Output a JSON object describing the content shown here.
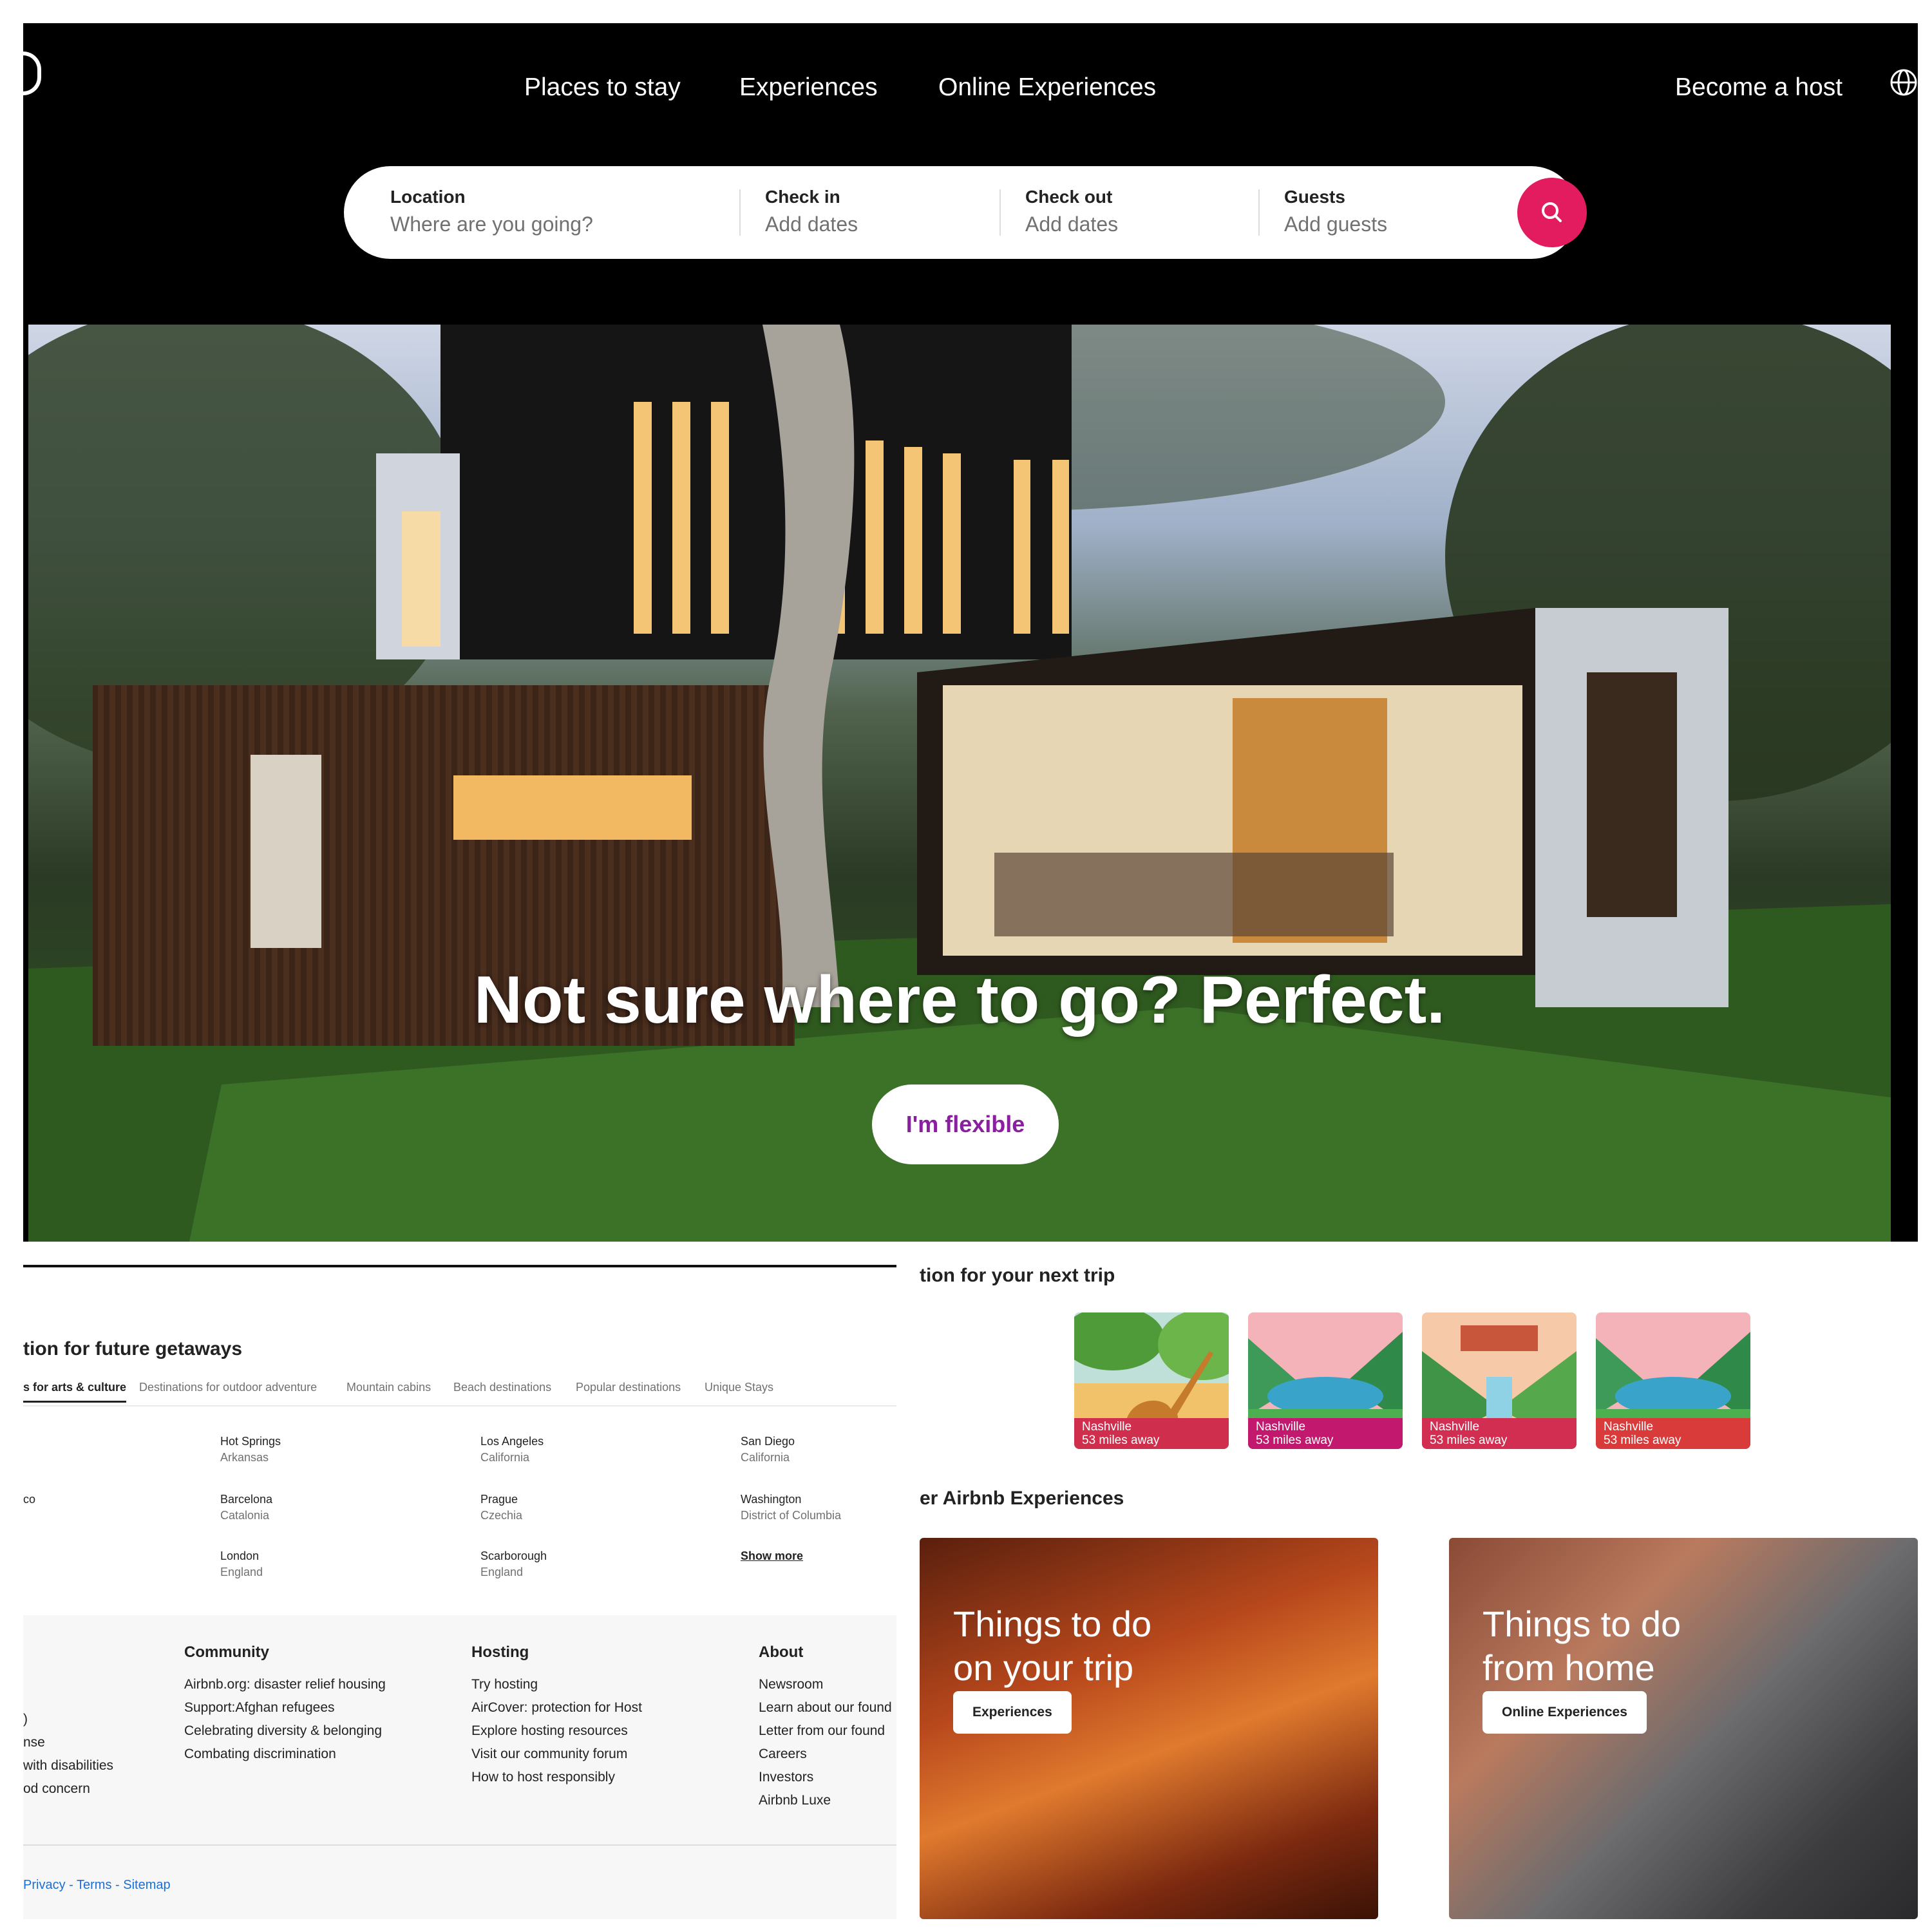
{
  "nav": {
    "links": [
      "Places to stay",
      "Experiences",
      "Online Experiences"
    ],
    "host_label": "Become a host",
    "globe_icon": "globe-icon"
  },
  "search": {
    "location_label": "Location",
    "location_placeholder": "Where are you going?",
    "checkin_label": "Check in",
    "checkin_placeholder": "Add dates",
    "checkout_label": "Check out",
    "checkout_placeholder": "Add dates",
    "guests_label": "Guests",
    "guests_placeholder": "Add guests",
    "button_icon": "search-icon",
    "accent": "#e31c5f"
  },
  "hero": {
    "headline": "Not sure where to go? Perfect.",
    "button_label": "I'm flexible",
    "button_color": "#8a1fa0"
  },
  "getaways": {
    "title": "tion for future getaways",
    "tabs": [
      "s for arts & culture",
      "Destinations for outdoor adventure",
      "Mountain cabins",
      "Beach destinations",
      "Popular destinations",
      "Unique Stays"
    ],
    "partial_city": "co",
    "destinations": [
      {
        "city": "Hot Springs",
        "region": "Arkansas"
      },
      {
        "city": "Los Angeles",
        "region": "California"
      },
      {
        "city": "San Diego",
        "region": "California"
      },
      {
        "city": "Barcelona",
        "region": "Catalonia"
      },
      {
        "city": "Prague",
        "region": "Czechia"
      },
      {
        "city": "Washington",
        "region": "District of Columbia"
      },
      {
        "city": "London",
        "region": "England"
      },
      {
        "city": "Scarborough",
        "region": "England"
      }
    ],
    "show_more": "Show more"
  },
  "footer": {
    "partial_items": [
      ")",
      "nse",
      "with disabilities",
      "od concern"
    ],
    "columns": [
      {
        "heading": "Community",
        "items": [
          "Airbnb.org: disaster relief housing",
          "Support:Afghan refugees",
          "Celebrating diversity & belonging",
          "Combating discrimination"
        ]
      },
      {
        "heading": "Hosting",
        "items": [
          "Try hosting",
          "AirCover: protection for Host",
          "Explore hosting resources",
          "Visit our community forum",
          "How to host responsibly"
        ]
      },
      {
        "heading": "About",
        "items": [
          "Newsroom",
          "Learn about our found",
          "Letter from our found",
          "Careers",
          "Investors",
          "Airbnb Luxe"
        ]
      }
    ],
    "legal": [
      "Privacy",
      "-",
      "Terms",
      "-",
      "Sitemap"
    ]
  },
  "nexttrip": {
    "title": "tion for your next trip",
    "cards": [
      {
        "city": "Nashville",
        "distance": "53 miles away",
        "color": "#cf2e4d"
      },
      {
        "city": "Nashville",
        "distance": "53 miles away",
        "color": "#c2186e"
      },
      {
        "city": "Nashville",
        "distance": "53 miles away",
        "color": "#d22e52"
      },
      {
        "city": "Nashville",
        "distance": "53 miles away",
        "color": "#d93b3b"
      }
    ]
  },
  "experiences": {
    "title": "er Airbnb Experiences",
    "items": [
      {
        "title_line1": "Things to do",
        "title_line2": "on your trip",
        "button": "Experiences"
      },
      {
        "title_line1": "Things to do",
        "title_line2": "from home",
        "button": "Online Experiences"
      }
    ]
  }
}
